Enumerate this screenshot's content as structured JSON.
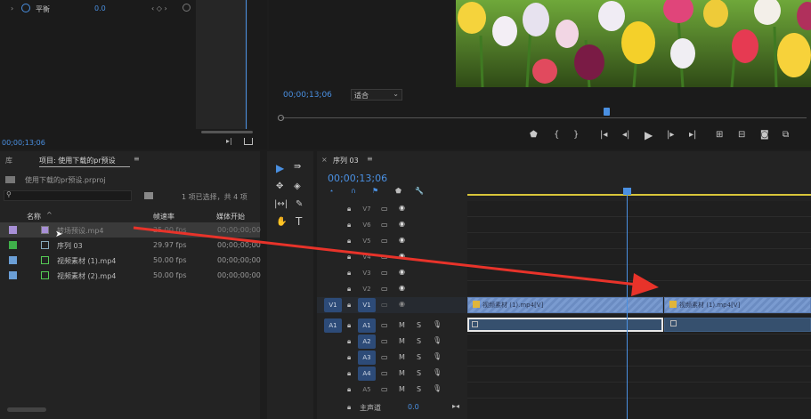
{
  "effect_controls": {
    "row_label": "平衡",
    "row_value": "0.0",
    "timecode": "00;00;13;06"
  },
  "program_monitor": {
    "timecode": "00;00;13;06",
    "fit_label": "适合"
  },
  "project_panel": {
    "library_tab": "库",
    "tab_title": "项目: 使用下载的pr预设",
    "file_name": "使用下载的pr预设.prproj",
    "selection_info": "1 项已选择，共 4 项",
    "columns": {
      "name": "名称",
      "frame_rate": "帧速率",
      "media_start": "媒体开始"
    },
    "items": [
      {
        "name": "转场预设.mp4",
        "fps": "25.00 fps",
        "start": "00;00;00;00",
        "swatch": "#a78fd6",
        "selected": true
      },
      {
        "name": "序列 03",
        "fps": "29.97 fps",
        "start": "00;00;00;00",
        "swatch": "#3fb04a",
        "selected": false
      },
      {
        "name": "视频素材 (1).mp4",
        "fps": "50.00 fps",
        "start": "00;00;00;00",
        "swatch": "#6b9fd6",
        "selected": false
      },
      {
        "name": "视频素材 (2).mp4",
        "fps": "50.00 fps",
        "start": "00;00;00;00",
        "swatch": "#6b9fd6",
        "selected": false
      }
    ]
  },
  "timeline": {
    "sequence_tab": "序列 03",
    "timecode": "00;00;13;06",
    "video_tracks": [
      "V7",
      "V6",
      "V5",
      "V4",
      "V3",
      "V2",
      "V1"
    ],
    "audio_tracks": [
      "A1",
      "A2",
      "A3",
      "A4",
      "A5"
    ],
    "source_v1": "V1",
    "source_a1": "A1",
    "master_label": "主声道",
    "master_value": "0.0",
    "clips": [
      {
        "label": "视频素材 (1).mp4[V]"
      },
      {
        "label": "视频素材 (1).mp4[V]"
      }
    ]
  },
  "colors": {
    "accent_blue": "#4a90e2",
    "arrow_red": "#e8332a",
    "clip_blue": "#7a9bd0"
  }
}
